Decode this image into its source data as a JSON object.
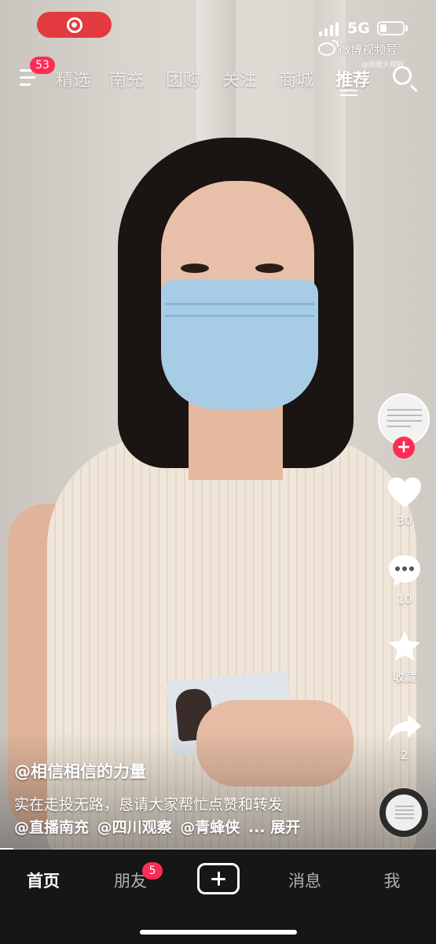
{
  "status_bar": {
    "network": "5G",
    "watermark": "微博视频号",
    "watermark_sub": "@别致大视野"
  },
  "top_nav": {
    "badge_count": "53",
    "tabs": [
      {
        "label": "精选",
        "active": false
      },
      {
        "label": "南充",
        "active": false
      },
      {
        "label": "团购",
        "active": false
      },
      {
        "label": "关注",
        "active": false
      },
      {
        "label": "商城",
        "active": false
      },
      {
        "label": "推荐",
        "active": true
      }
    ]
  },
  "right_rail": {
    "follow_label": "+",
    "likes": "30",
    "comments": "10",
    "favorite_label": "收藏",
    "shares": "2"
  },
  "caption": {
    "author": "@相信相信的力量",
    "description": "实在走投无路，恳请大家帮忙点赞和转发",
    "mentions": [
      "@直播南充",
      "@四川观察",
      "@青蜂侠"
    ],
    "more": "... 展开"
  },
  "progress": 0.03,
  "bottom_bar": {
    "tabs": [
      {
        "label": "首页",
        "active": true
      },
      {
        "label": "朋友",
        "active": false
      },
      {
        "label": "消息",
        "active": false
      },
      {
        "label": "我",
        "active": false
      }
    ],
    "friend_badge": "5"
  },
  "colors": {
    "accent": "#fe2c55",
    "record": "#e23a3f",
    "bottom_bar": "#161616"
  }
}
